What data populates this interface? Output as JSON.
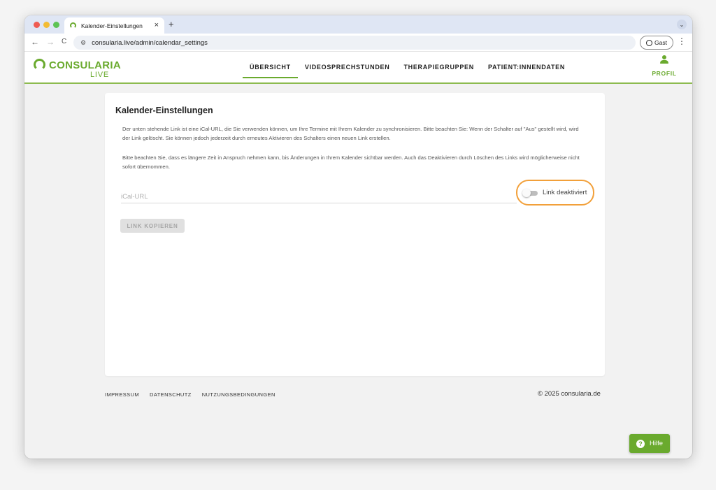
{
  "browser": {
    "tab_title": "Kalender-Einstellungen",
    "tab_close": "×",
    "new_tab": "+",
    "tab_dropdown": "⌄",
    "back": "←",
    "forward": "→",
    "reload": "C",
    "url": "consularia.live/admin/calendar_settings",
    "guest_label": "Gast",
    "menu": "⋮"
  },
  "header": {
    "logo_word": "CONSULARIA",
    "logo_sub": "LIVE",
    "nav": [
      {
        "label": "ÜBERSICHT",
        "active": true
      },
      {
        "label": "VIDEOSPRECHSTUNDEN",
        "active": false
      },
      {
        "label": "THERAPIEGRUPPEN",
        "active": false
      },
      {
        "label": "PATIENT:INNENDATEN",
        "active": false
      }
    ],
    "profile_label": "PROFIL"
  },
  "settings": {
    "title": "Kalender-Einstellungen",
    "paragraph1": "Der unten stehende Link ist eine iCal-URL, die Sie verwenden können, um Ihre Termine mit Ihrem Kalender zu synchronisieren. Bitte beachten Sie: Wenn der Schalter auf \"Aus\" gestellt wird, wird der Link gelöscht. Sie können jedoch jederzeit durch erneutes Aktivieren des Schalters einen neuen Link erstellen.",
    "paragraph2": "Bitte beachten Sie, dass es längere Zeit in Anspruch nehmen kann, bis Änderungen in Ihrem Kalender sichtbar werden. Auch das Deaktivieren durch Löschen des Links wird möglicherweise nicht sofort übernommen.",
    "ical_placeholder": "iCal-URL",
    "ical_value": "",
    "toggle_label": "Link deaktiviert",
    "toggle_on": false,
    "copy_button": "LINK KOPIEREN"
  },
  "footer": {
    "links": [
      "IMPRESSUM",
      "DATENSCHUTZ",
      "NUTZUNGSBEDINGUNGEN"
    ],
    "copyright": "© 2025 consularia.de"
  },
  "help": {
    "label": "Hilfe",
    "icon": "?"
  },
  "colors": {
    "brand_green": "#6aaa2e",
    "highlight_orange": "#f2a03a"
  }
}
